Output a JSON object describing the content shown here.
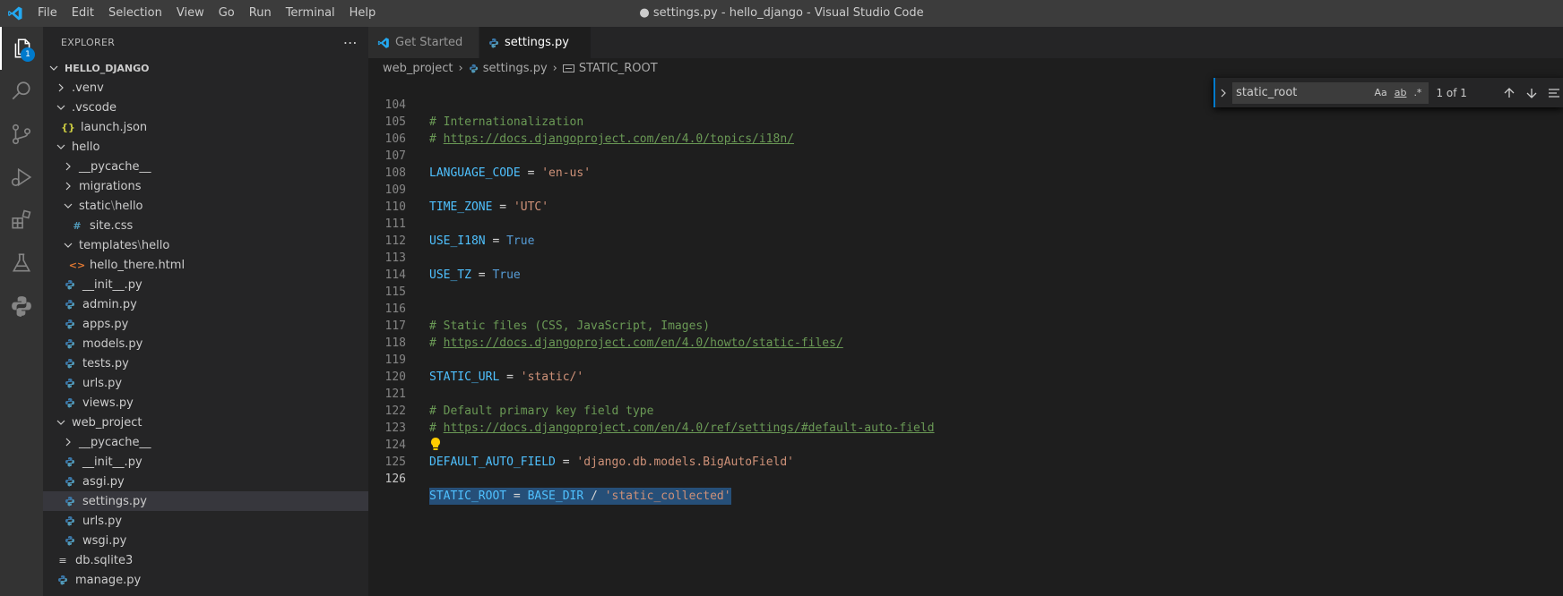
{
  "window_title": "● settings.py - hello_django - Visual Studio Code",
  "menu": [
    "File",
    "Edit",
    "Selection",
    "View",
    "Go",
    "Run",
    "Terminal",
    "Help"
  ],
  "activity": {
    "explorer_badge": "1"
  },
  "explorer": {
    "title": "EXPLORER",
    "root": "HELLO_DJANGO",
    "items": [
      {
        "label": ".venv"
      },
      {
        "label": ".vscode"
      },
      {
        "label": "launch.json"
      },
      {
        "label": "hello"
      },
      {
        "label": "__pycache__"
      },
      {
        "label": "migrations"
      },
      {
        "label": "static",
        "sep": "\\",
        "label2": "hello"
      },
      {
        "label": "site.css"
      },
      {
        "label": "templates",
        "sep": "\\",
        "label2": "hello"
      },
      {
        "label": "hello_there.html"
      },
      {
        "label": "__init__.py"
      },
      {
        "label": "admin.py"
      },
      {
        "label": "apps.py"
      },
      {
        "label": "models.py"
      },
      {
        "label": "tests.py"
      },
      {
        "label": "urls.py"
      },
      {
        "label": "views.py"
      },
      {
        "label": "web_project"
      },
      {
        "label": "__pycache__"
      },
      {
        "label": "__init__.py"
      },
      {
        "label": "asgi.py"
      },
      {
        "label": "settings.py"
      },
      {
        "label": "urls.py"
      },
      {
        "label": "wsgi.py"
      },
      {
        "label": "db.sqlite3"
      },
      {
        "label": "manage.py"
      }
    ]
  },
  "tabs": [
    {
      "label": "Get Started"
    },
    {
      "label": "settings.py"
    }
  ],
  "breadcrumb": [
    "web_project",
    "settings.py",
    "STATIC_ROOT"
  ],
  "find": {
    "value": "static_root",
    "match_case": "Aa",
    "whole_word": "ab",
    "regex": ".*",
    "count": "1 of 1"
  },
  "code": {
    "lines": [
      {
        "n": "104",
        "t": "# Internationalization"
      },
      {
        "n": "105",
        "t1": "# ",
        "t2": "https://docs.djangoproject.com/en/4.0/topics/i18n/"
      },
      {
        "n": "106"
      },
      {
        "n": "107",
        "var": "LANGUAGE_CODE",
        "op": " = ",
        "val": "'en-us'"
      },
      {
        "n": "108"
      },
      {
        "n": "109",
        "var": "TIME_ZONE",
        "op": " = ",
        "val": "'UTC'"
      },
      {
        "n": "110"
      },
      {
        "n": "111",
        "var": "USE_I18N",
        "op": " = ",
        "val": "True"
      },
      {
        "n": "112"
      },
      {
        "n": "113",
        "var": "USE_TZ",
        "op": " = ",
        "val": "True"
      },
      {
        "n": "114"
      },
      {
        "n": "115"
      },
      {
        "n": "116",
        "t": "# Static files (CSS, JavaScript, Images)"
      },
      {
        "n": "117",
        "t1": "# ",
        "t2": "https://docs.djangoproject.com/en/4.0/howto/static-files/"
      },
      {
        "n": "118"
      },
      {
        "n": "119",
        "var": "STATIC_URL",
        "op": " = ",
        "val": "'static/'"
      },
      {
        "n": "120"
      },
      {
        "n": "121",
        "t": "# Default primary key field type"
      },
      {
        "n": "122",
        "t1": "# ",
        "t2": "https://docs.djangoproject.com/en/4.0/ref/settings/#default-auto-field"
      },
      {
        "n": "123"
      },
      {
        "n": "124",
        "var": "DEFAULT_AUTO_FIELD",
        "op": " = ",
        "val": "'django.db.models.BigAutoField'"
      },
      {
        "n": "125"
      },
      {
        "n": "126",
        "var": "STATIC_ROOT",
        "op1": " = ",
        "var2": "BASE_DIR",
        "op2": " / ",
        "val": "'static_collected'"
      }
    ]
  }
}
